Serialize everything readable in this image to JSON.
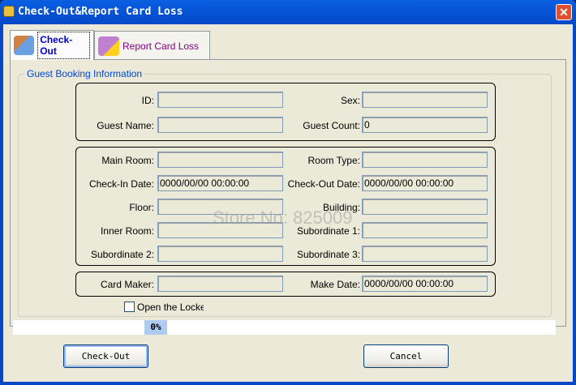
{
  "window": {
    "title": "Check-Out&Report Card Loss",
    "close": "✕"
  },
  "tabs": [
    {
      "label": "Check-Out",
      "color": "#0000c0"
    },
    {
      "label": "Report Card Loss",
      "color": "#800080"
    }
  ],
  "group": {
    "title": "Guest Booking Information"
  },
  "fields": {
    "id": {
      "label": "ID:",
      "value": ""
    },
    "sex": {
      "label": "Sex:",
      "value": ""
    },
    "guest_name": {
      "label": "Guest Name:",
      "value": ""
    },
    "guest_count": {
      "label": "Guest Count:",
      "value": "0"
    },
    "main_room": {
      "label": "Main Room:",
      "value": ""
    },
    "room_type": {
      "label": "Room Type:",
      "value": ""
    },
    "check_in": {
      "label": "Check-In Date:",
      "value": "0000/00/00 00:00:00"
    },
    "check_out": {
      "label": "Check-Out Date:",
      "value": "0000/00/00 00:00:00"
    },
    "floor": {
      "label": "Floor:",
      "value": ""
    },
    "building": {
      "label": "Building:",
      "value": ""
    },
    "inner_room": {
      "label": "Inner Room:",
      "value": ""
    },
    "sub1": {
      "label": "Subordinate 1:",
      "value": ""
    },
    "sub2": {
      "label": "Subordinate 2:",
      "value": ""
    },
    "sub3": {
      "label": "Subordinate 3:",
      "value": ""
    },
    "card_maker": {
      "label": "Card Maker:",
      "value": ""
    },
    "make_date": {
      "label": "Make Date:",
      "value": "0000/00/00 00:00:00"
    }
  },
  "open_lock": {
    "label": "Open the Locke",
    "checked": false
  },
  "progress": {
    "label": "0%",
    "value": 0
  },
  "buttons": {
    "checkout": "Check-Out",
    "cancel": "Cancel"
  },
  "watermark": "Store No: 825009"
}
